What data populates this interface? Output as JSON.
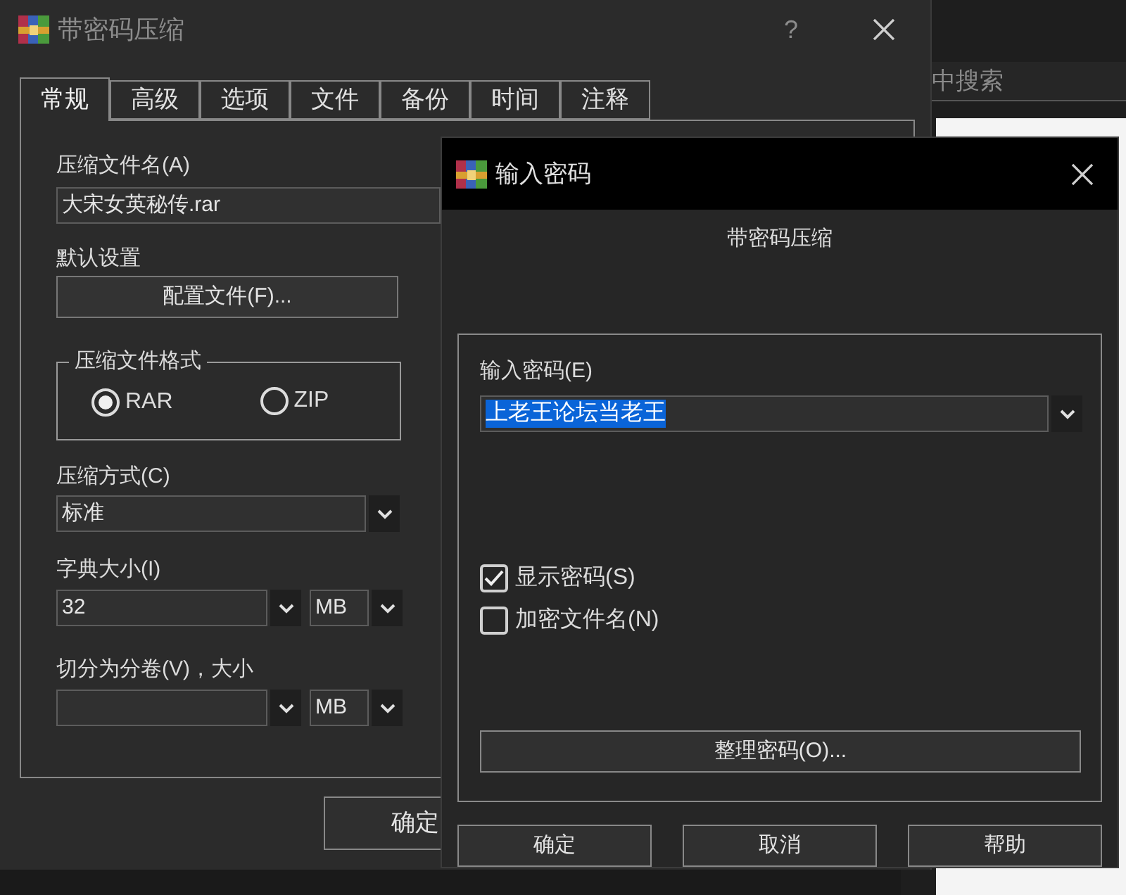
{
  "background": {
    "search_text": "中搜索"
  },
  "main_dialog": {
    "title": "带密码压缩",
    "help": "?",
    "tabs": [
      {
        "label": "常规",
        "selected": true
      },
      {
        "label": "高级",
        "selected": false
      },
      {
        "label": "选项",
        "selected": false
      },
      {
        "label": "文件",
        "selected": false
      },
      {
        "label": "备份",
        "selected": false
      },
      {
        "label": "时间",
        "selected": false
      },
      {
        "label": "注释",
        "selected": false
      }
    ],
    "archive_name_label": "压缩文件名(A)",
    "archive_name": "大宋女英秘传.rar",
    "profile_label": "默认设置",
    "profile_button": "配置文件(F)...",
    "format_group": "压缩文件格式",
    "formats": [
      {
        "label": "RAR",
        "selected": true
      },
      {
        "label": "ZIP",
        "selected": false
      }
    ],
    "method_label": "压缩方式(C)",
    "method": "标准",
    "dict_label": "字典大小(I)",
    "dict_size": "32",
    "dict_unit": "MB",
    "volume_label": "切分为分卷(V)，大小",
    "volume_unit": "MB",
    "ok_button": "确定"
  },
  "password_dialog": {
    "title": "输入密码",
    "subtitle": "带密码压缩",
    "password_label": "输入密码(E)",
    "password": "上老王论坛当老王",
    "password_selected": true,
    "options": [
      {
        "label": "显示密码(S)",
        "checked": true
      },
      {
        "label": "加密文件名(N)",
        "checked": false
      }
    ],
    "organize_button": "整理密码(O)...",
    "buttons": [
      "确定",
      "取消",
      "帮助"
    ]
  }
}
